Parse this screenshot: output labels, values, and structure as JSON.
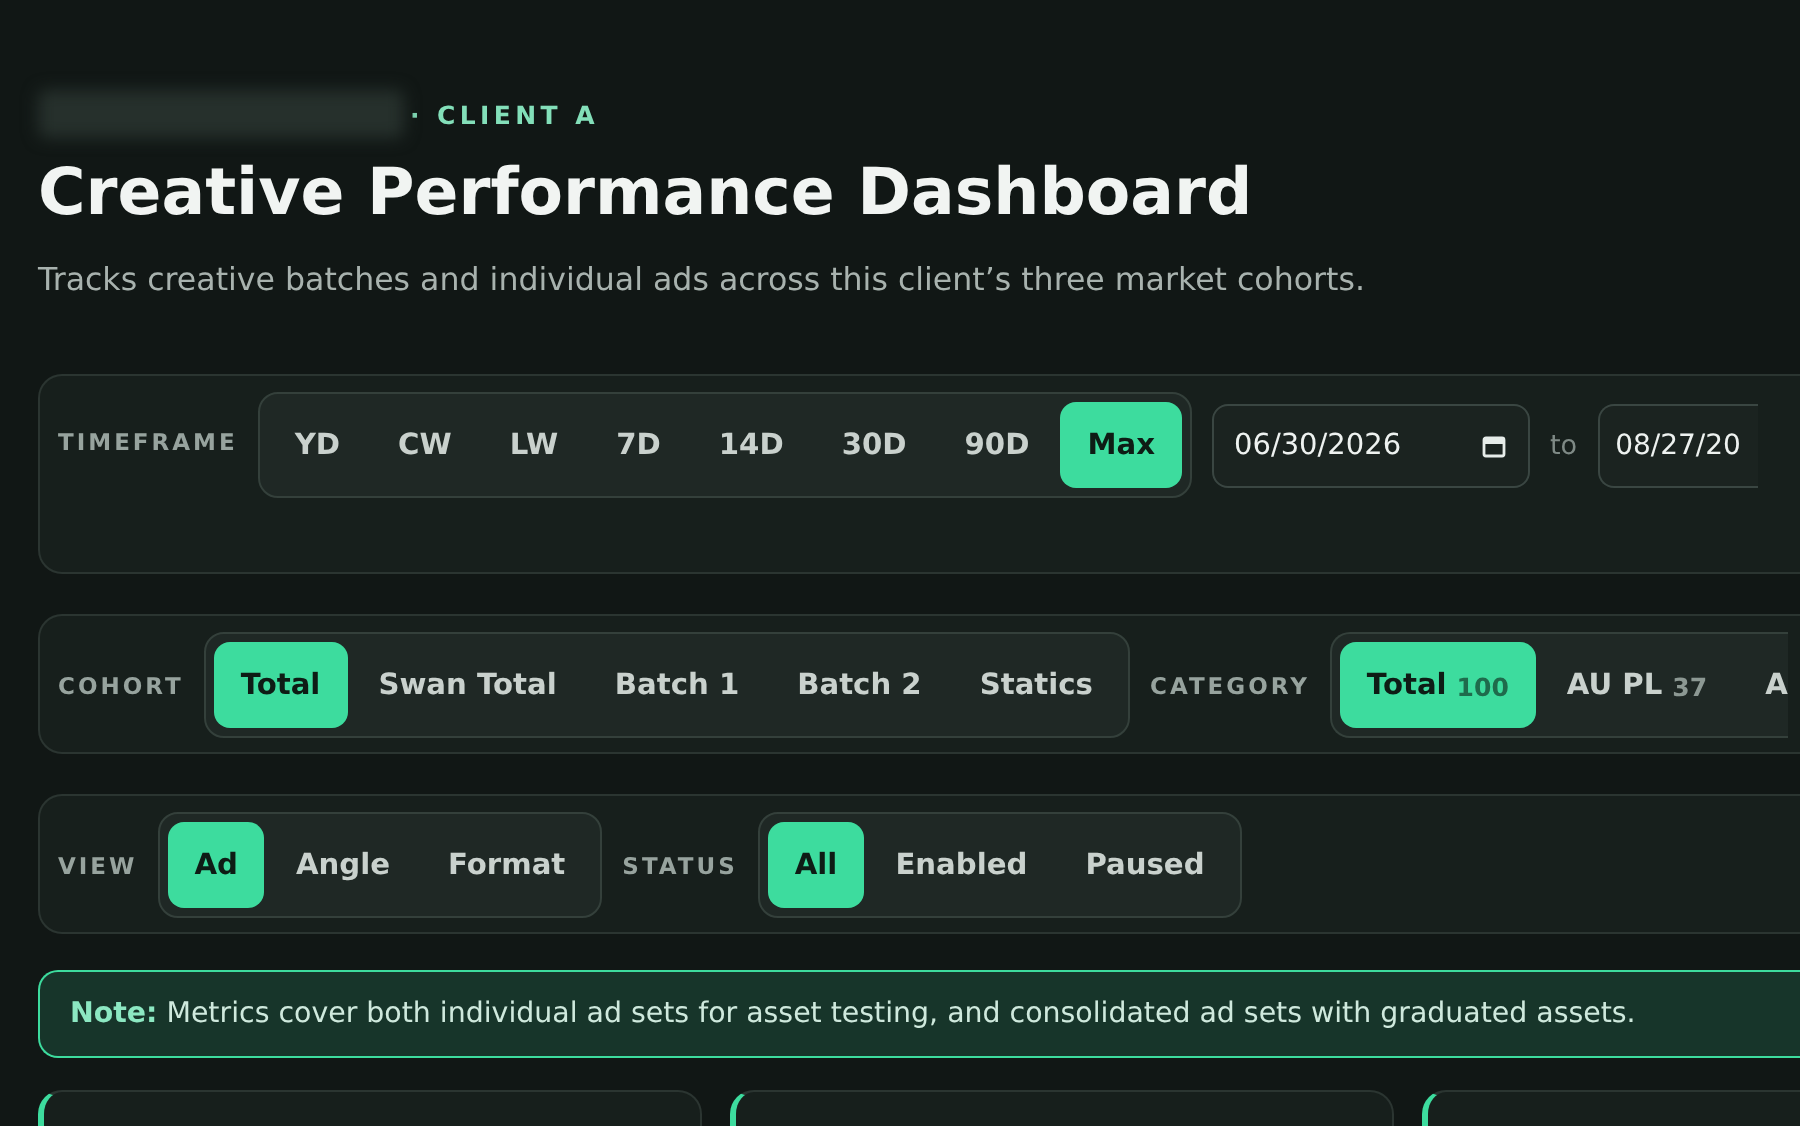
{
  "header": {
    "eyebrow": "· CLIENT A",
    "title": "Creative Performance Dashboard",
    "subtitle": "Tracks creative batches and individual ads across this client’s three market cohorts."
  },
  "timeframe": {
    "label": "TIMEFRAME",
    "options": [
      {
        "label": "YD",
        "selected": false
      },
      {
        "label": "CW",
        "selected": false
      },
      {
        "label": "LW",
        "selected": false
      },
      {
        "label": "7D",
        "selected": false
      },
      {
        "label": "14D",
        "selected": false
      },
      {
        "label": "30D",
        "selected": false
      },
      {
        "label": "90D",
        "selected": false
      },
      {
        "label": "Max",
        "selected": true
      }
    ],
    "start_date": "06/30/2026",
    "separator": "to",
    "end_date": "08/27/20"
  },
  "cohort": {
    "label": "COHORT",
    "options": [
      {
        "label": "Total",
        "selected": true
      },
      {
        "label": "Swan Total",
        "selected": false
      },
      {
        "label": "Batch 1",
        "selected": false
      },
      {
        "label": "Batch 2",
        "selected": false
      },
      {
        "label": "Statics",
        "selected": false
      }
    ]
  },
  "category": {
    "label": "CATEGORY",
    "options": [
      {
        "label": "Total",
        "count": "100",
        "selected": true
      },
      {
        "label": "AU PL",
        "count": "37",
        "selected": false
      },
      {
        "label": "A",
        "selected": false
      }
    ]
  },
  "view": {
    "label": "VIEW",
    "options": [
      {
        "label": "Ad",
        "selected": true
      },
      {
        "label": "Angle",
        "selected": false
      },
      {
        "label": "Format",
        "selected": false
      }
    ]
  },
  "status": {
    "label": "STATUS",
    "options": [
      {
        "label": "All",
        "selected": true
      },
      {
        "label": "Enabled",
        "selected": false
      },
      {
        "label": "Paused",
        "selected": false
      }
    ]
  },
  "note": "**Note:** Metrics cover both individual ad sets for asset testing, and consolidated ad sets with graduated assets."
}
